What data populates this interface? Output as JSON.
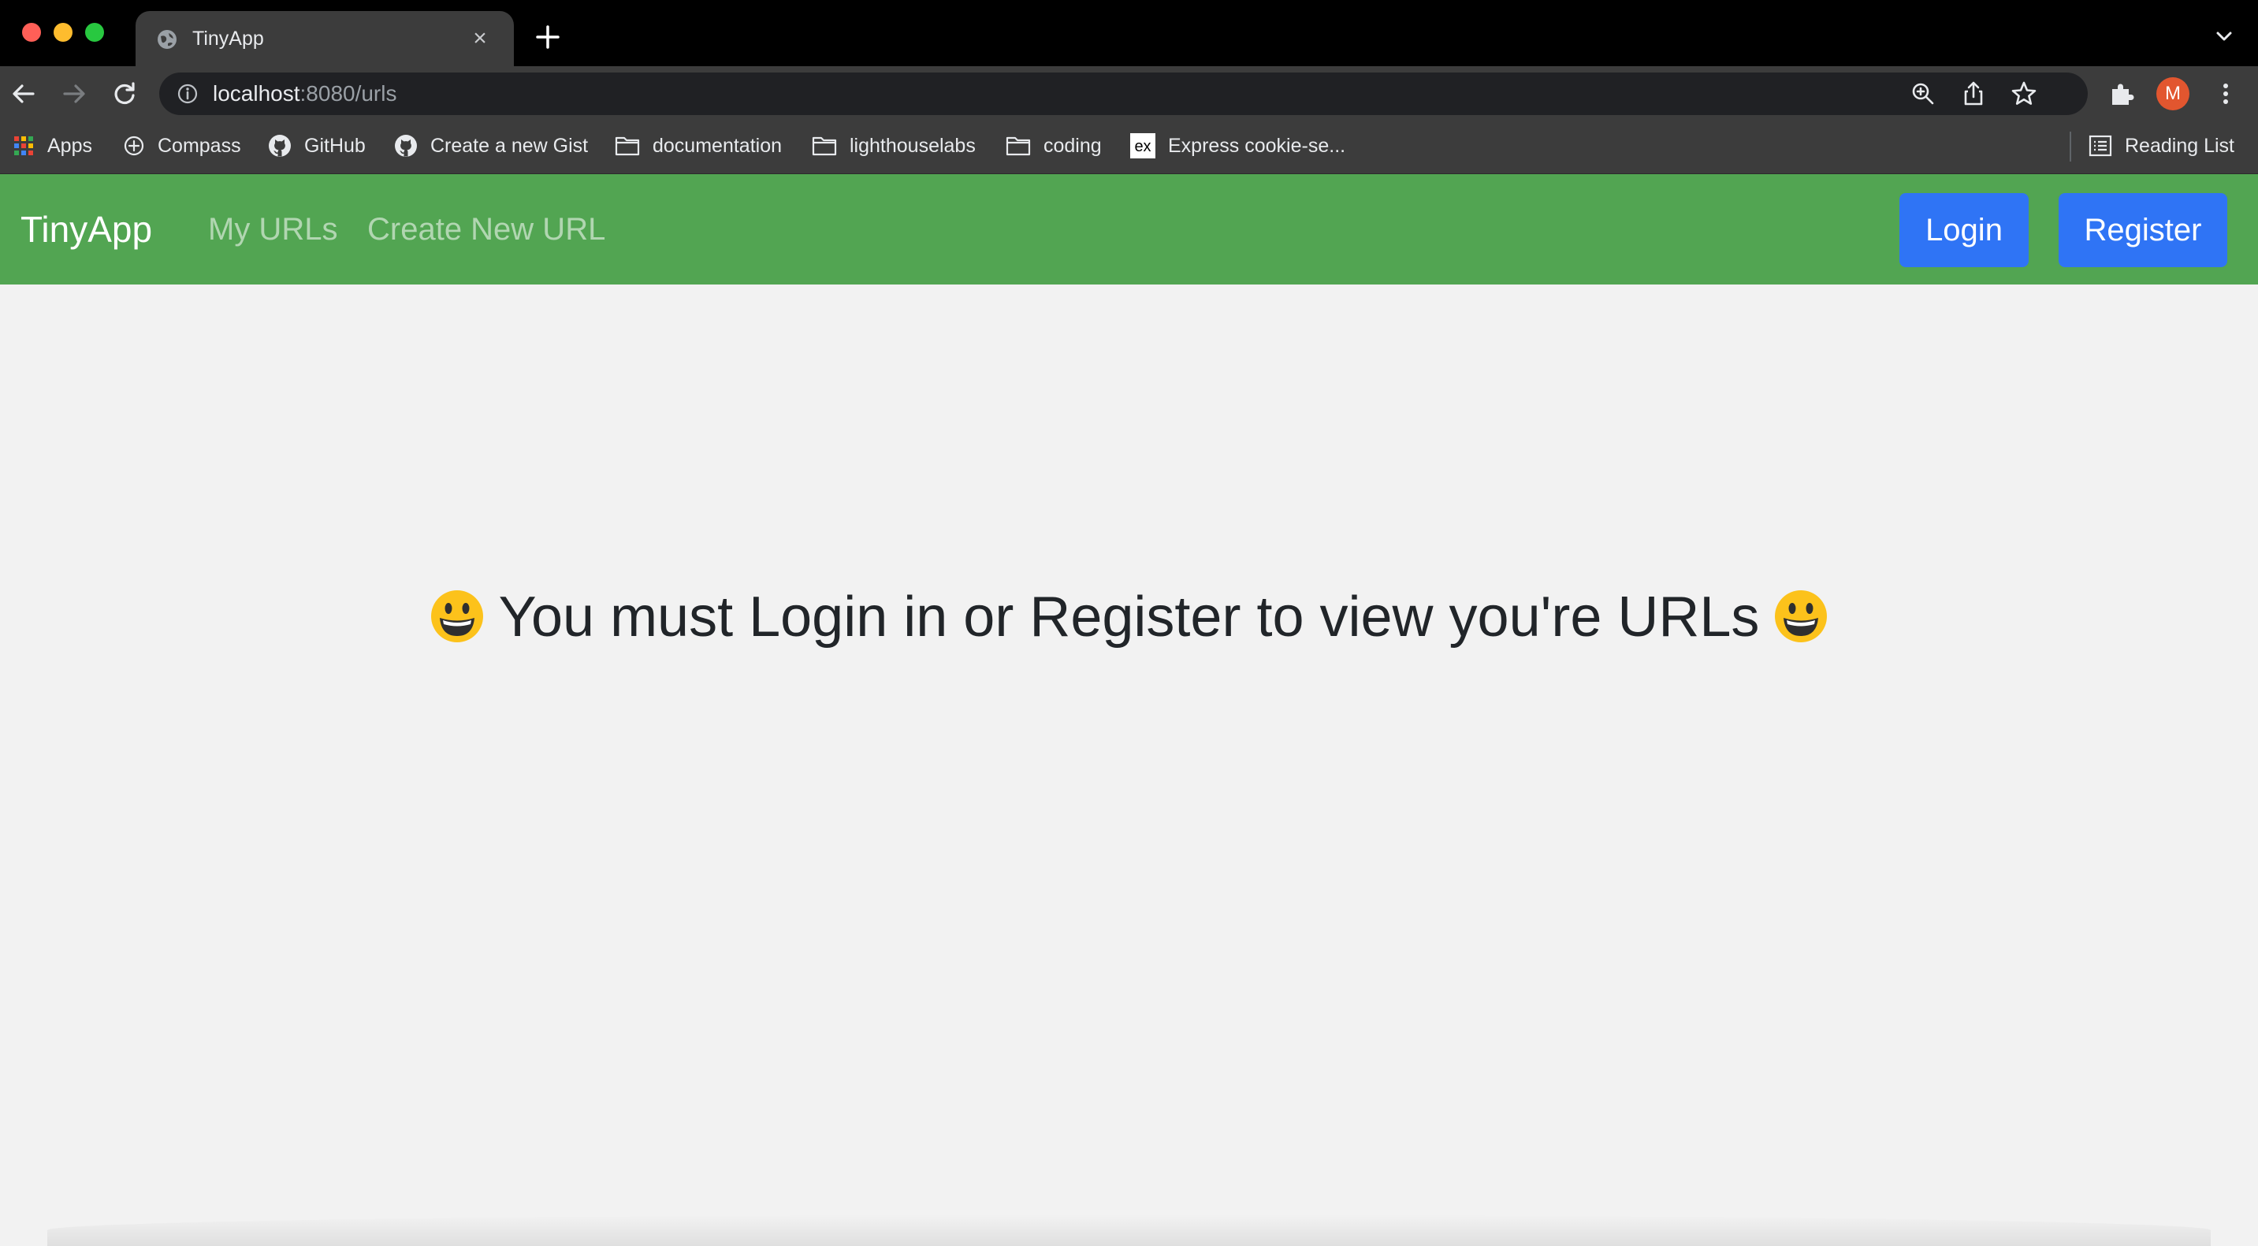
{
  "browser": {
    "tab": {
      "title": "TinyApp"
    },
    "address": {
      "host": "localhost",
      "rest": ":8080/urls"
    },
    "profile_initial": "M",
    "bookmarks": [
      {
        "label": "Apps",
        "icon": "apps-grid-icon"
      },
      {
        "label": "Compass",
        "icon": "compass-icon"
      },
      {
        "label": "GitHub",
        "icon": "github-icon"
      },
      {
        "label": "Create a new Gist",
        "icon": "github-icon"
      },
      {
        "label": "documentation",
        "icon": "folder-icon"
      },
      {
        "label": "lighthouselabs",
        "icon": "folder-icon"
      },
      {
        "label": "coding",
        "icon": "folder-icon"
      },
      {
        "label": "Express cookie-se...",
        "icon": "express-icon"
      }
    ],
    "reading_list": "Reading List"
  },
  "navbar": {
    "brand": "TinyApp",
    "links": [
      "My URLs",
      "Create New URL"
    ],
    "login": "Login",
    "register": "Register",
    "color": "#52a552",
    "button_color": "#2f74f5"
  },
  "main": {
    "message": "You must Login in or Register to view you're URLs",
    "emoji": "grinning-face-emoji"
  }
}
